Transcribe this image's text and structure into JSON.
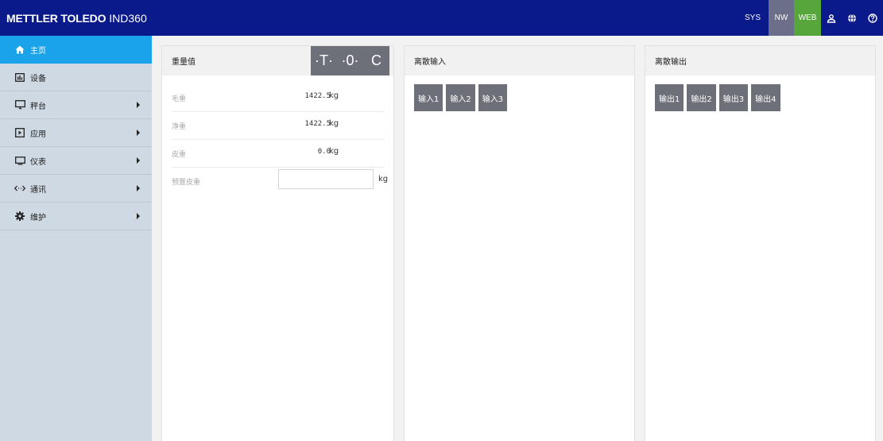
{
  "header": {
    "brand_bold": "METTLER TOLEDO",
    "brand_model": "IND360",
    "sys_label": "SYS",
    "nw_label": "NW",
    "web_label": "WEB",
    "icons": [
      "user-icon",
      "globe-icon",
      "help-icon"
    ],
    "colors": {
      "bar": "#0b1a8a",
      "nw": "#6c6f8a",
      "web": "#56a63c"
    }
  },
  "sidebar": {
    "items": [
      {
        "label": "主页",
        "icon": "home-icon",
        "active": true
      },
      {
        "label": "设备",
        "icon": "device-icon"
      },
      {
        "label": "秤台",
        "icon": "monitor-icon",
        "submenu": true
      },
      {
        "label": "应用",
        "icon": "app-icon",
        "submenu": true
      },
      {
        "label": "仪表",
        "icon": "screen-icon",
        "submenu": true
      },
      {
        "label": "通讯",
        "icon": "arrows-icon",
        "submenu": true
      },
      {
        "label": "维护",
        "icon": "gear-icon",
        "submenu": true
      }
    ],
    "active_color": "#1aa3e8"
  },
  "weight": {
    "title": "重量值",
    "keys": {
      "tare": "·T·",
      "zero": "·0·",
      "clear": "C"
    },
    "gross_label": "毛重",
    "gross_value": "1422.5",
    "gross_unit": "kg",
    "net_label": "净重",
    "net_value": "1422.5",
    "net_unit": "kg",
    "tare_label": "皮重",
    "tare_value": "0.0",
    "tare_unit": "kg",
    "preset_label": "预置皮重",
    "preset_value": "",
    "preset_unit": "kg"
  },
  "inputs": {
    "title": "离散输入",
    "buttons": [
      "输入1",
      "输入2",
      "输入3"
    ]
  },
  "outputs": {
    "title": "离散输出",
    "buttons": [
      "输出1",
      "输出2",
      "输出3",
      "输出4"
    ]
  }
}
